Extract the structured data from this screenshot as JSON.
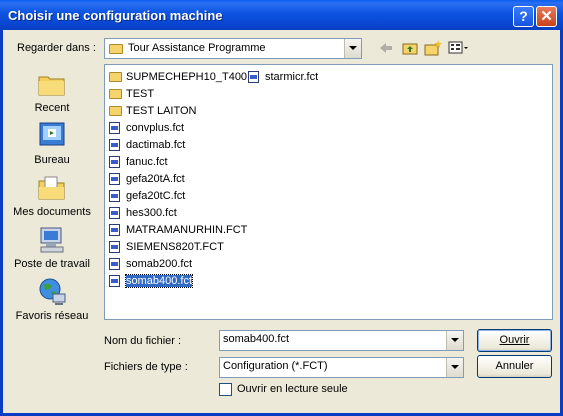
{
  "window": {
    "title": "Choisir une configuration machine",
    "help_label": "?",
    "close_label": "✕"
  },
  "lookin": {
    "label": "Regarder dans :",
    "value": "Tour Assistance Programme"
  },
  "toolbar": {
    "icons": [
      "back-icon",
      "up-folder-icon",
      "new-folder-icon",
      "view-menu-icon"
    ]
  },
  "places": [
    {
      "label": "Recent"
    },
    {
      "label": "Bureau"
    },
    {
      "label": "Mes documents"
    },
    {
      "label": "Poste de travail"
    },
    {
      "label": "Favoris réseau"
    }
  ],
  "files": [
    {
      "name": "SUPMECHEPH10_T400",
      "type": "folder"
    },
    {
      "name": "TEST",
      "type": "folder"
    },
    {
      "name": "TEST LAITON",
      "type": "folder"
    },
    {
      "name": "convplus.fct",
      "type": "file"
    },
    {
      "name": "dactimab.fct",
      "type": "file"
    },
    {
      "name": "fanuc.fct",
      "type": "file"
    },
    {
      "name": "gefa20tA.fct",
      "type": "file"
    },
    {
      "name": "gefa20tC.fct",
      "type": "file"
    },
    {
      "name": "hes300.fct",
      "type": "file"
    },
    {
      "name": "MATRAMANURHIN.FCT",
      "type": "file"
    },
    {
      "name": "SIEMENS820T.FCT",
      "type": "file"
    },
    {
      "name": "somab200.fct",
      "type": "file"
    },
    {
      "name": "somab400.fct",
      "type": "file",
      "selected": true
    },
    {
      "name": "starmicr.fct",
      "type": "file"
    }
  ],
  "filename": {
    "label": "Nom du fichier :",
    "value": "somab400.fct"
  },
  "filetype": {
    "label": "Fichiers de type :",
    "value": "Configuration (*.FCT)"
  },
  "readonly": {
    "label": "Ouvrir en lecture seule",
    "checked": false
  },
  "buttons": {
    "open": "Ouvrir",
    "cancel": "Annuler"
  },
  "colors": {
    "titlebar": "#0a46d2",
    "face": "#ece9d8",
    "selection": "#316ac5"
  }
}
